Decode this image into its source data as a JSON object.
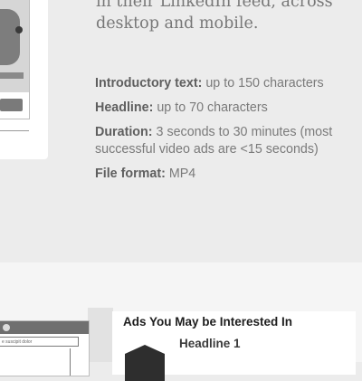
{
  "intro": {
    "line1": "in their LinkedIn feed, across",
    "line2": "desktop and mobile."
  },
  "specs": [
    {
      "label": "Introductory text:",
      "value": "up to 150 characters"
    },
    {
      "label": "Headline:",
      "value": "up to 70 characters"
    },
    {
      "label": "Duration:",
      "value": "3 seconds to 30 minutes (most successful video ads are <15 seconds)"
    },
    {
      "label": "File format:",
      "value": "MP4"
    }
  ],
  "desktop_preview": {
    "input_text": "e suscipit dolor"
  },
  "ads": {
    "title": "Ads You May be Interested In",
    "headline": "Headline 1"
  }
}
